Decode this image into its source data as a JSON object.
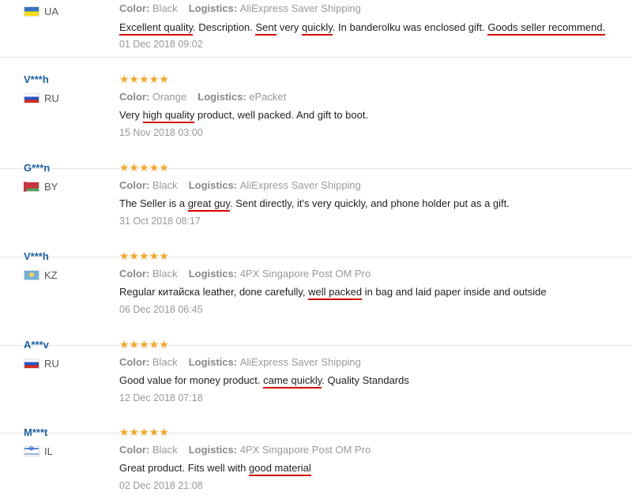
{
  "labels": {
    "color": "Color:",
    "logistics": "Logistics:"
  },
  "reviews": [
    {
      "user": "",
      "country": "UA",
      "flag": "ua",
      "stars": "",
      "color": "Black",
      "logistics": "AliExpress Saver Shipping",
      "text_parts": [
        {
          "t": "Excellent quality",
          "u": true
        },
        {
          "t": ". Description. ",
          "u": false
        },
        {
          "t": "Sent",
          "u": true
        },
        {
          "t": " very ",
          "u": false
        },
        {
          "t": "quickly",
          "u": true
        },
        {
          "t": ". In banderolku was enclosed gift. ",
          "u": false
        },
        {
          "t": "Goods seller recommend.",
          "u": true
        }
      ],
      "date": "01 Dec 2018 09:02"
    },
    {
      "user": "V***h",
      "country": "RU",
      "flag": "ru",
      "stars": "★★★★★",
      "color": "Orange",
      "logistics": "ePacket",
      "text_parts": [
        {
          "t": "Very ",
          "u": false
        },
        {
          "t": "high quality",
          "u": true
        },
        {
          "t": " product, well packed. And gift to boot.",
          "u": false
        }
      ],
      "date": "15 Nov 2018 03:00"
    },
    {
      "user": "G***n",
      "country": "BY",
      "flag": "by",
      "stars": "★★★★★",
      "color": "Black",
      "logistics": "AliExpress Saver Shipping",
      "text_parts": [
        {
          "t": "The Seller is a ",
          "u": false
        },
        {
          "t": "great guy",
          "u": true
        },
        {
          "t": ". Sent directly, it's very quickly, and phone holder put as a gift.",
          "u": false
        }
      ],
      "date": "31 Oct 2018 08:17"
    },
    {
      "user": "V***h",
      "country": "KZ",
      "flag": "kz",
      "stars": "★★★★★",
      "color": "Black",
      "logistics": "4PX Singapore Post OM Pro",
      "text_parts": [
        {
          "t": "Regular китайcка leather, done carefully, ",
          "u": false
        },
        {
          "t": "well packed",
          "u": true
        },
        {
          "t": " in bag and laid paper inside and outside",
          "u": false
        }
      ],
      "date": "06 Dec 2018 06:45"
    },
    {
      "user": "A***v",
      "country": "RU",
      "flag": "ru",
      "stars": "★★★★★",
      "color": "Black",
      "logistics": "AliExpress Saver Shipping",
      "text_parts": [
        {
          "t": "Good value for money product. ",
          "u": false
        },
        {
          "t": "came quickly",
          "u": true
        },
        {
          "t": ". Quality Standards",
          "u": false
        }
      ],
      "date": "12 Dec 2018 07:18"
    },
    {
      "user": "M***t",
      "country": "IL",
      "flag": "il",
      "stars": "★★★★★",
      "color": "Black",
      "logistics": "4PX Singapore Post OM Pro",
      "text_parts": [
        {
          "t": "Great product. Fits well with ",
          "u": false
        },
        {
          "t": "good material",
          "u": true
        }
      ],
      "date": "02 Dec 2018 21:08"
    }
  ]
}
